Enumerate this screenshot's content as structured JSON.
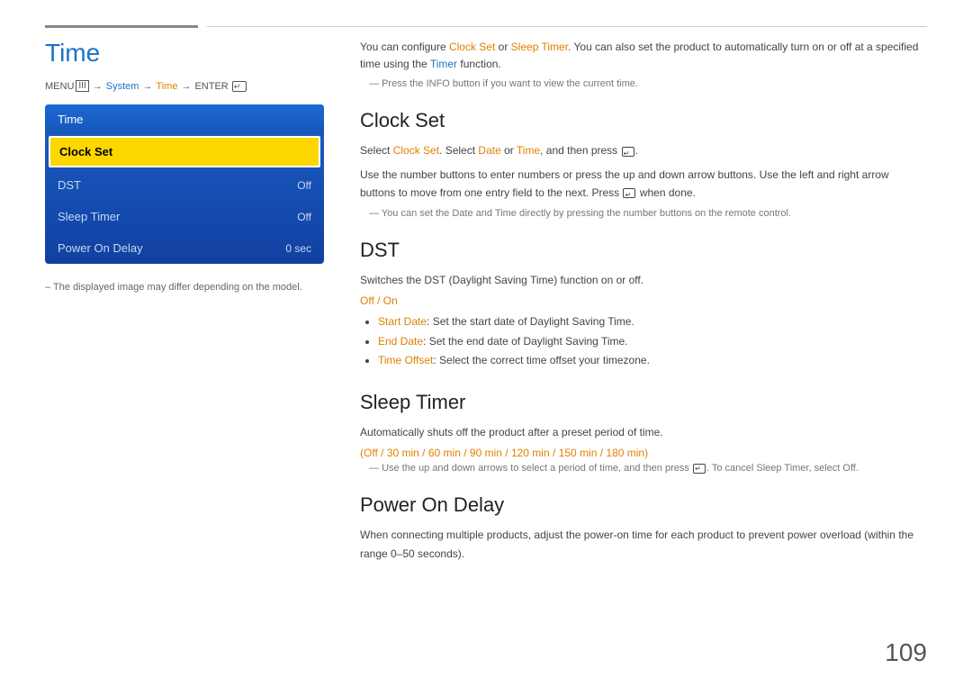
{
  "page": {
    "number": "109"
  },
  "topbar": {
    "note_image": "The displayed image may differ depending on the model."
  },
  "left": {
    "title": "Time",
    "breadcrumb": {
      "menu": "MENU",
      "sep1": "→",
      "system": "System",
      "sep2": "→",
      "time": "Time",
      "sep3": "→",
      "enter": "ENTER"
    },
    "menu_header": "Time",
    "menu_items": [
      {
        "label": "Clock Set",
        "value": "",
        "active": true
      },
      {
        "label": "DST",
        "value": "Off",
        "active": false
      },
      {
        "label": "Sleep Timer",
        "value": "Off",
        "active": false
      },
      {
        "label": "Power On Delay",
        "value": "0 sec",
        "active": false
      }
    ]
  },
  "right": {
    "intro": "You can configure Clock Set or Sleep Timer. You can also set the product to automatically turn on or off at a specified time using the Timer function.",
    "intro_note": "Press the INFO button if you want to view the current time.",
    "sections": [
      {
        "id": "clock-set",
        "title": "Clock Set",
        "body1": "Select Clock Set. Select Date or Time, and then press ↵.",
        "body2": "Use the number buttons to enter numbers or press the up and down arrow buttons. Use the left and right arrow buttons to move from one entry field to the next. Press ↵ when done.",
        "note": "You can set the Date and Time directly by pressing the number buttons on the remote control.",
        "bullets": []
      },
      {
        "id": "dst",
        "title": "DST",
        "body1": "Switches the DST (Daylight Saving Time) function on or off.",
        "options": "Off / On",
        "bullets": [
          {
            "label": "Start Date",
            "text": ": Set the start date of Daylight Saving Time."
          },
          {
            "label": "End Date",
            "text": ": Set the end date of Daylight Saving Time."
          },
          {
            "label": "Time Offset",
            "text": ": Select the correct time offset your timezone."
          }
        ]
      },
      {
        "id": "sleep-timer",
        "title": "Sleep Timer",
        "body1": "Automatically shuts off the product after a preset period of time.",
        "options": "(Off / 30 min / 60 min / 90 min / 120 min / 150 min / 180 min)",
        "note": "Use the up and down arrows to select a period of time, and then press ↵. To cancel Sleep Timer, select Off.",
        "bullets": []
      },
      {
        "id": "power-on-delay",
        "title": "Power On Delay",
        "body1": "When connecting multiple products, adjust the power-on time for each product to prevent power overload (within the range 0–50 seconds).",
        "bullets": []
      }
    ]
  }
}
